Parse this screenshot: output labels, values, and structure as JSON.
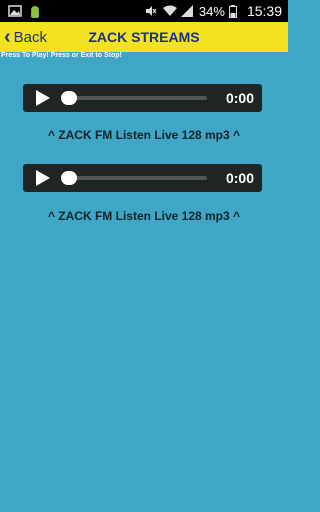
{
  "statusbar": {
    "battery": "34%",
    "clock": "15:39"
  },
  "appbar": {
    "back_label": "Back",
    "title": "ZACK STREAMS"
  },
  "hint": "Press To Play! Press or Exit to Stop!",
  "players": [
    {
      "time": "0:00",
      "progress": 0,
      "caption": "^ ZACK FM Listen Live 128 mp3 ^"
    },
    {
      "time": "0:00",
      "progress": 0,
      "caption": "^ ZACK FM Listen Live 128 mp3 ^"
    }
  ],
  "colors": {
    "background": "#3fa6c6",
    "appbar": "#f2e21f",
    "title": "#1d2f8c",
    "player": "#1f2424"
  }
}
